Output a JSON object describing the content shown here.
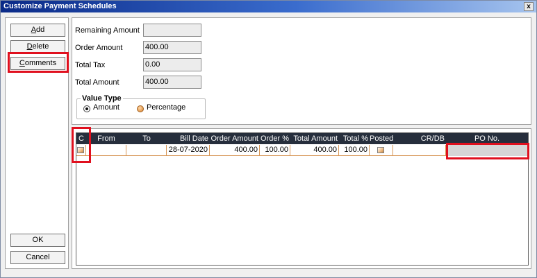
{
  "window": {
    "title": "Customize Payment Schedules",
    "close_label": "x"
  },
  "buttons": {
    "add": {
      "pre": "",
      "key": "A",
      "post": "dd"
    },
    "delete": {
      "pre": "",
      "key": "D",
      "post": "elete"
    },
    "comments": {
      "pre": "",
      "key": "C",
      "post": "omments"
    },
    "ok": "OK",
    "cancel": "Cancel"
  },
  "fields": [
    {
      "label": "Remaining Amount",
      "value": ""
    },
    {
      "label": "Order Amount",
      "value": "400.00"
    },
    {
      "label": "Total Tax",
      "value": "0.00"
    },
    {
      "label": "Total Amount",
      "value": "400.00"
    }
  ],
  "value_type": {
    "legend": "Value Type",
    "options": [
      {
        "label": "Amount",
        "selected": true
      },
      {
        "label": "Percentage",
        "selected": false
      }
    ]
  },
  "grid": {
    "columns": [
      "C",
      "From",
      "To",
      "Bill Date",
      "Order Amount",
      "Order %",
      "Total Amount",
      "Total %",
      "Posted",
      "CR/DB Amount",
      "PO No."
    ],
    "rows": [
      {
        "c_checked": false,
        "from": "",
        "to": "",
        "bill_date": "28-07-2020",
        "order_amount": "400.00",
        "order_pct": "100.00",
        "total_amount": "400.00",
        "total_pct": "100.00",
        "posted": false,
        "crdb_amount": "",
        "po_no": ""
      }
    ]
  },
  "colors": {
    "title_gradient_start": "#0a2a88",
    "title_gradient_end": "#a6c4ee",
    "grid_header": "#262e3c",
    "row_border": "#d79656",
    "highlight": "#e0101e"
  }
}
